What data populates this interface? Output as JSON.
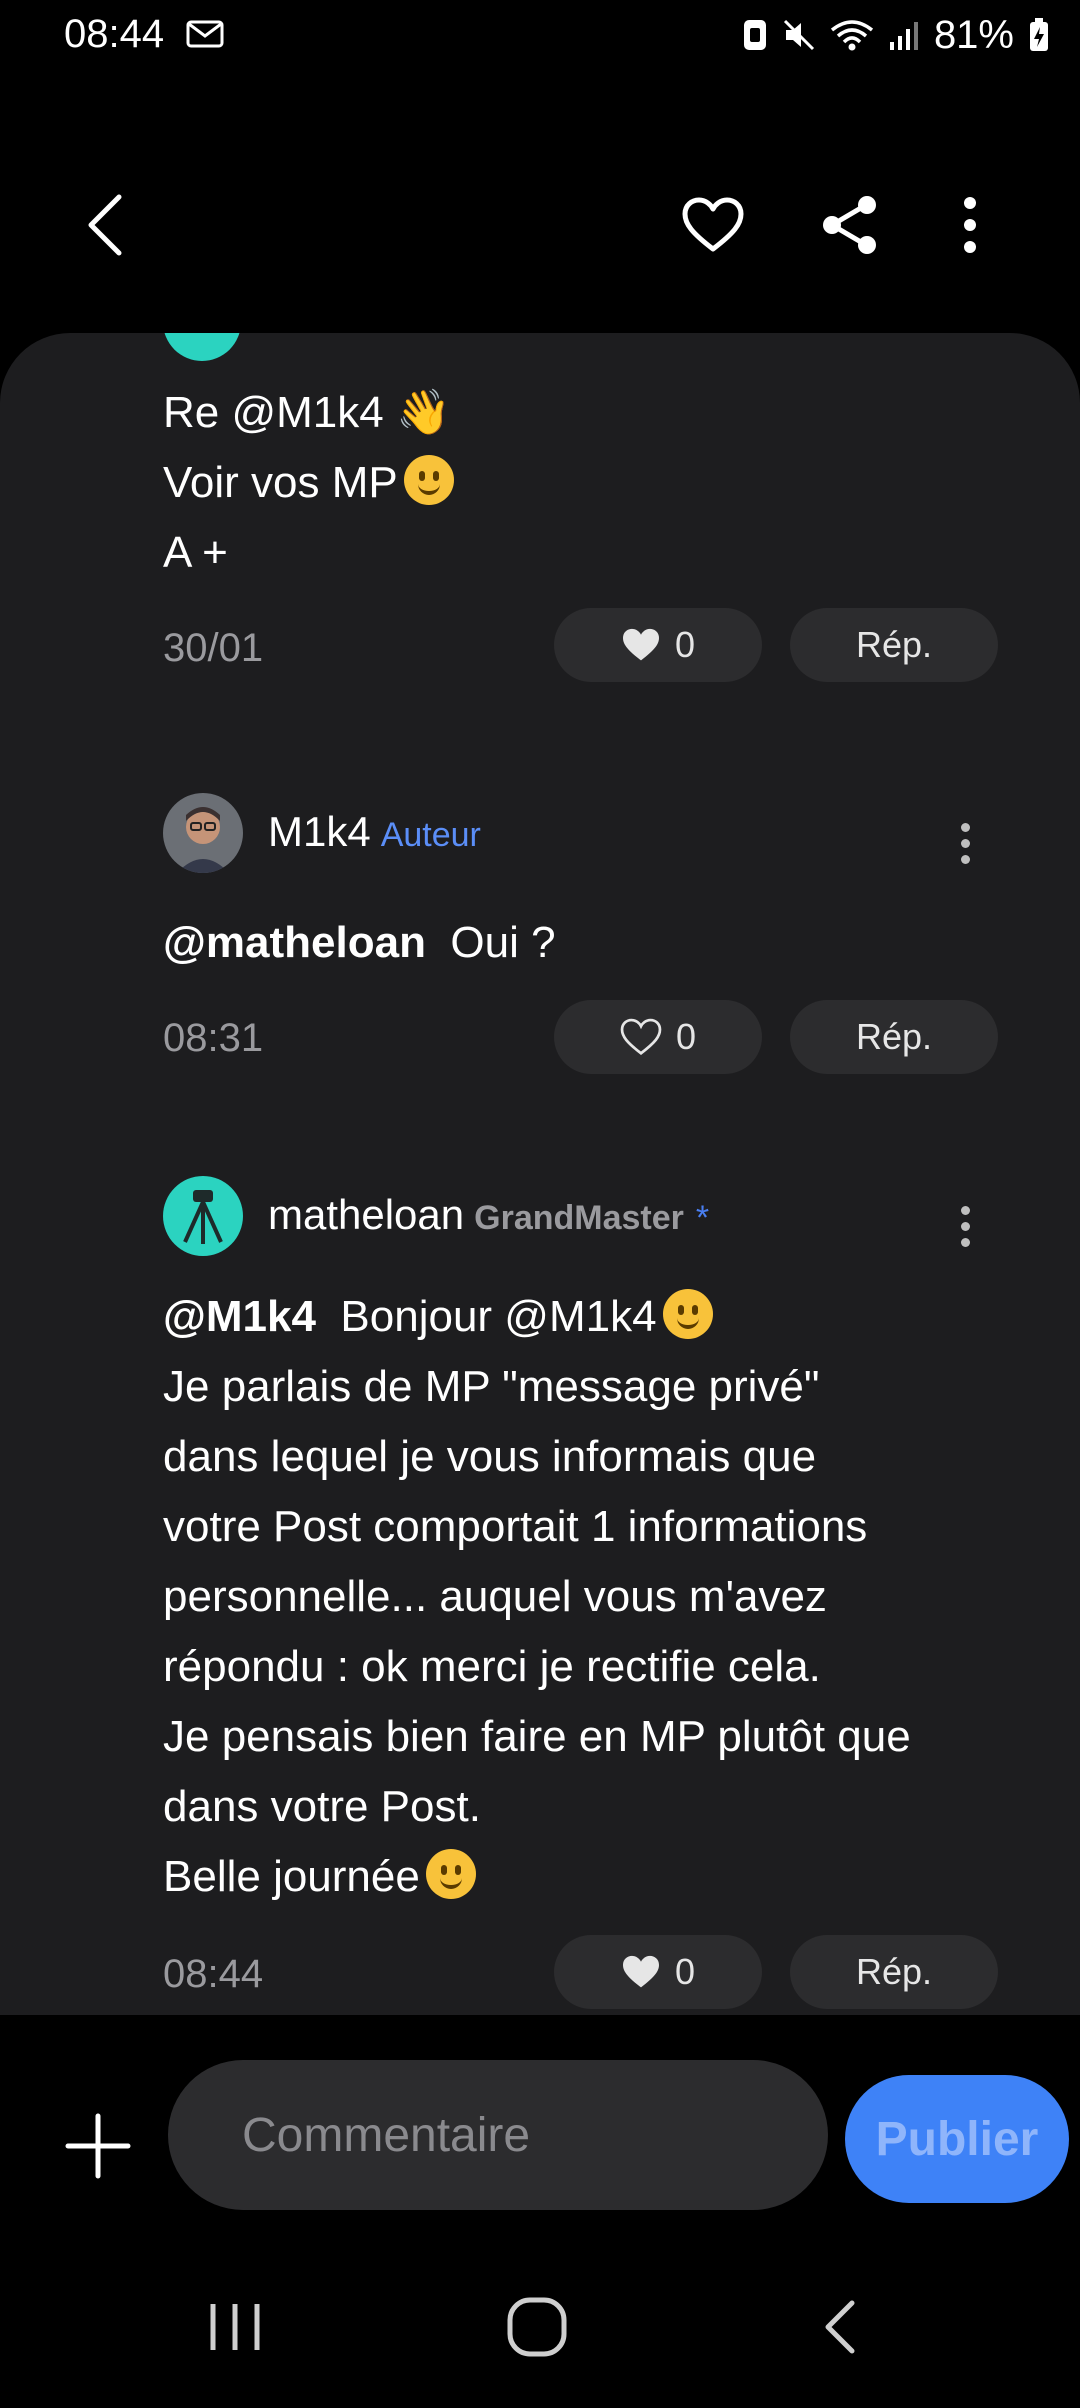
{
  "status_bar": {
    "time": "08:44",
    "battery": "81%"
  },
  "comments": [
    {
      "lines": [
        "Re @M1k4 👋",
        "Voir vos MP",
        "A +"
      ],
      "date": "30/01",
      "likes": "0",
      "reply_label": "Rép."
    },
    {
      "username": "M1k4",
      "badge": "Auteur",
      "mention": "@matheloan",
      "text": "Oui ?",
      "date": "08:31",
      "likes": "0",
      "reply_label": "Rép."
    },
    {
      "username": "matheloan",
      "badge": "GrandMaster",
      "badge_star": "*",
      "mention": "@M1k4",
      "first_line_text": "Bonjour @M1k4",
      "lines": [
        "Je parlais de MP \"message privé\"",
        "dans lequel je vous informais que",
        "votre Post comportait 1 informations",
        "personnelle... auquel vous m'avez",
        "répondu : ok merci je rectifie cela.",
        "Je pensais bien faire en MP plutôt que",
        "dans votre Post.",
        "Belle journée"
      ],
      "date": "08:44",
      "likes": "0",
      "reply_label": "Rép."
    }
  ],
  "composer": {
    "placeholder": "Commentaire",
    "publish_label": "Publier"
  },
  "colors": {
    "accent": "#3e82f7",
    "author_badge": "#5b8ef7",
    "sheet_bg": "#1d1d1f",
    "pill_bg": "#2c2c2e"
  },
  "icons": [
    "back-arrow-icon",
    "heart-icon",
    "share-icon",
    "more-vertical-icon",
    "mail-icon",
    "wifi-icon",
    "signal-icon",
    "mute-icon",
    "battery-icon",
    "plus-icon",
    "recents-icon",
    "home-icon",
    "nav-back-icon"
  ]
}
